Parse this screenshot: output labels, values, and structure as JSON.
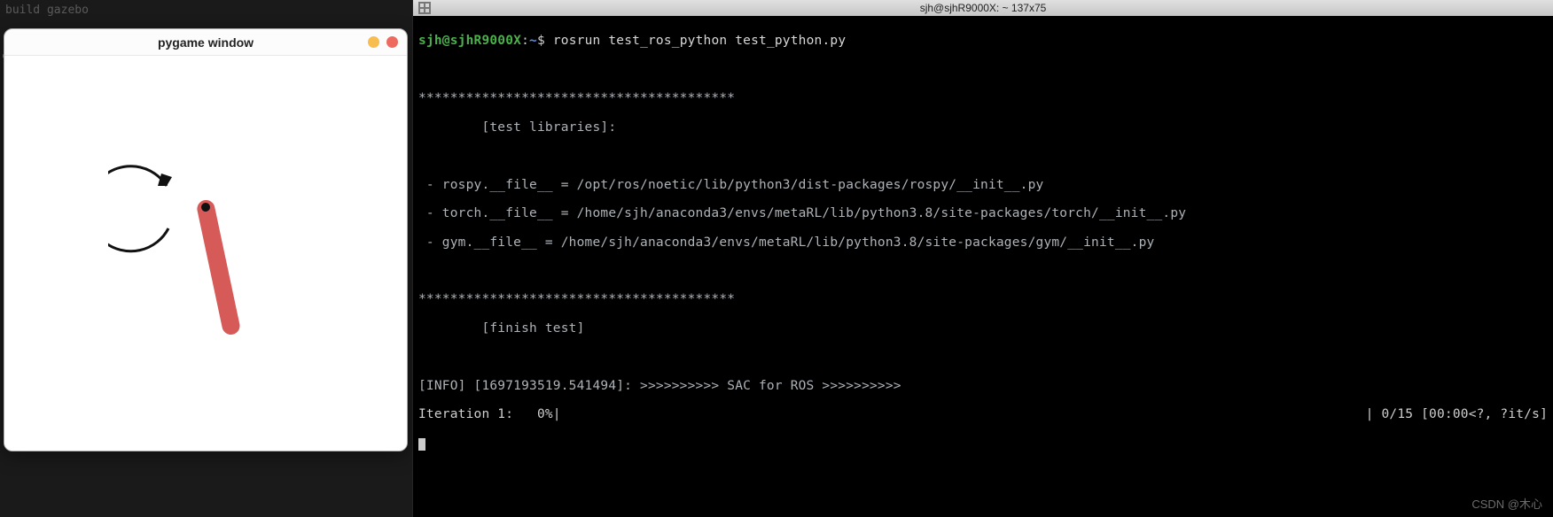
{
  "desktop": {
    "bg_line1": "build gazebo"
  },
  "pygame": {
    "title": "pygame window"
  },
  "terminal": {
    "window_title": "sjh@sjhR9000X: ~ 137x75",
    "prompt_user_host": "sjh@sjhR9000X",
    "prompt_sep": ":",
    "prompt_path": "~",
    "prompt_dollar": "$",
    "command": "rosrun test_ros_python test_python.py",
    "stars1": "****************************************",
    "sec1_label": "        [test libraries]:",
    "line_rospy": " - rospy.__file__ = /opt/ros/noetic/lib/python3/dist-packages/rospy/__init__.py",
    "line_torch": " - torch.__file__ = /home/sjh/anaconda3/envs/metaRL/lib/python3.8/site-packages/torch/__init__.py",
    "line_gym": " - gym.__file__ = /home/sjh/anaconda3/envs/metaRL/lib/python3.8/site-packages/gym/__init__.py",
    "stars2": "****************************************",
    "sec2_label": "        [finish test]",
    "info_line": "[INFO] [1697193519.541494]: >>>>>>>>>> SAC for ROS >>>>>>>>>>",
    "progress_left": "Iteration 1:   0%|",
    "progress_right": "| 0/15 [00:00<?, ?it/s]"
  },
  "watermark": "CSDN @木心"
}
